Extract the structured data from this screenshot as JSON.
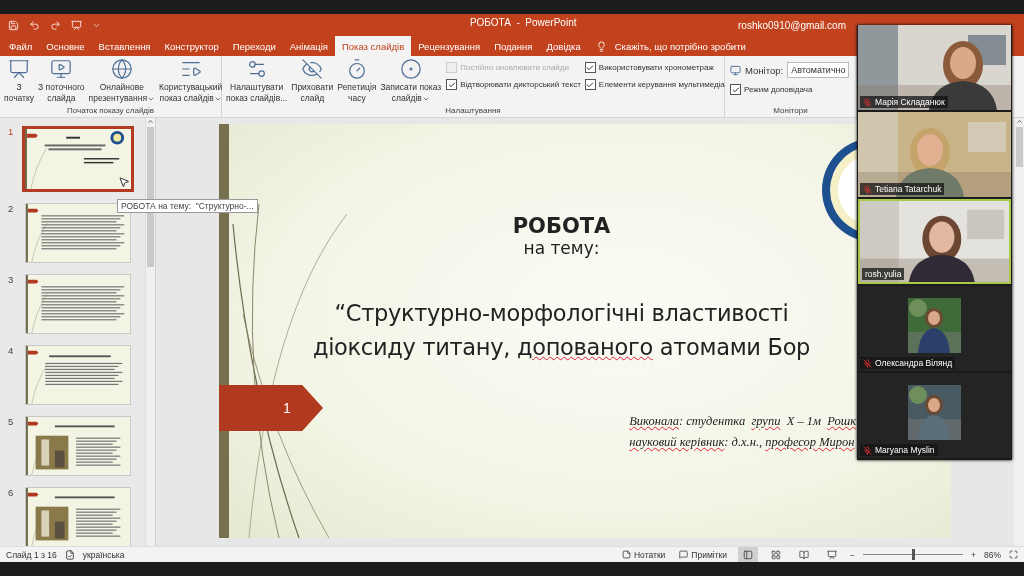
{
  "title_bar": {
    "title": "РОБОТА  -  PowerPoint",
    "account": "roshko0910@gmail.com"
  },
  "tabs": [
    {
      "label": "Файл",
      "selected": false
    },
    {
      "label": "Основне",
      "selected": false
    },
    {
      "label": "Вставлення",
      "selected": false
    },
    {
      "label": "Конструктор",
      "selected": false
    },
    {
      "label": "Переходи",
      "selected": false
    },
    {
      "label": "Анімація",
      "selected": false
    },
    {
      "label": "Показ слайдів",
      "selected": true
    },
    {
      "label": "Рецензування",
      "selected": false
    },
    {
      "label": "Подання",
      "selected": false
    },
    {
      "label": "Довідка",
      "selected": false
    }
  ],
  "tell_me": "Скажіть, що потрібно зробити",
  "ribbon_groups": [
    {
      "label": "Початок показу слайдів",
      "items": [
        {
          "kind": "button",
          "lines": [
            "З",
            "початку"
          ],
          "has_menu": false
        },
        {
          "kind": "button",
          "lines": [
            "З поточного",
            "слайда"
          ],
          "has_menu": false
        },
        {
          "kind": "button",
          "lines": [
            "Онлайнове",
            "презентування"
          ],
          "has_menu": true
        },
        {
          "kind": "button",
          "lines": [
            "Користувацький",
            "показ слайдів"
          ],
          "has_menu": true
        }
      ]
    },
    {
      "label": "Налаштування",
      "items": [
        {
          "kind": "button",
          "lines": [
            "Налаштувати",
            "показ слайдів..."
          ],
          "has_menu": false
        },
        {
          "kind": "button",
          "lines": [
            "Приховати",
            "слайд"
          ],
          "has_menu": false
        },
        {
          "kind": "button",
          "lines": [
            "Репетиція",
            "часу"
          ],
          "has_menu": false
        },
        {
          "kind": "button",
          "lines": [
            "Записати показ",
            "слайдів"
          ],
          "has_menu": true
        },
        {
          "kind": "checkboxes",
          "checkboxes": [
            {
              "label": "Постійно оновлювати слайди",
              "checked": false,
              "disabled": true
            },
            {
              "label": "Відтворювати дикторський текст",
              "checked": true,
              "disabled": false
            }
          ]
        },
        {
          "kind": "checkboxes",
          "checkboxes": [
            {
              "label": "Використовувати хронометраж",
              "checked": true,
              "disabled": false
            },
            {
              "label": "Елементи керування мультимедіа",
              "checked": true,
              "disabled": false
            }
          ]
        }
      ]
    },
    {
      "label": "Монітори",
      "items": [
        {
          "kind": "monitor",
          "label": "Монітор:",
          "value": "Автоматично",
          "checkboxes": [
            {
              "label": "Режим доповідача",
              "checked": true,
              "disabled": false
            }
          ]
        }
      ]
    }
  ],
  "thumbnails": [
    {
      "number": "1",
      "selected": true
    },
    {
      "number": "2",
      "selected": false
    },
    {
      "number": "3",
      "selected": false
    },
    {
      "number": "4",
      "selected": false
    },
    {
      "number": "5",
      "selected": false
    },
    {
      "number": "6",
      "selected": false
    }
  ],
  "tooltip": "РОБОТА на тему:  \"Структурно-...",
  "slide": {
    "number": "1",
    "heading": "РОБОТА",
    "subheading": "на тему:",
    "title_lines": [
      [
        {
          "text": "“Структурно-морфологічні властивості",
          "misspelled": false
        }
      ],
      [
        {
          "text": "діоксиду титану, ",
          "misspelled": false
        },
        {
          "text": "допованого",
          "misspelled": true
        },
        {
          "text": " атомами Бор",
          "misspelled": false
        }
      ]
    ],
    "credit_lines": [
      [
        {
          "text": "Виконала",
          "misspelled": true
        },
        {
          "text": ": студентка  ",
          "misspelled": false
        },
        {
          "text": "групи",
          "misspelled": true
        },
        {
          "text": "  Х – 1м  ",
          "misspelled": false
        },
        {
          "text": "Рошк",
          "misspelled": true
        }
      ],
      [
        {
          "text": "науковий керівник",
          "misspelled": true
        },
        {
          "text": ": д.х.н., ",
          "misspelled": false
        },
        {
          "text": "професор Мирон",
          "misspelled": true
        }
      ]
    ]
  },
  "video_call": {
    "participants": [
      {
        "name": "Марія Складанюк",
        "kind": "video",
        "muted": true,
        "speaking": false
      },
      {
        "name": "Tetiana Tatarchuk",
        "kind": "video",
        "muted": true,
        "speaking": false
      },
      {
        "name": "rosh.yulia",
        "kind": "video",
        "muted": false,
        "speaking": true
      },
      {
        "name": "Олександра Вілянд",
        "muted": true,
        "speaking": false
      },
      {
        "name": "Maryana Myslin",
        "muted": true,
        "speaking": false
      }
    ]
  },
  "status_bar": {
    "slide_position": "Слайд 1 з 16",
    "language": "українська",
    "notes": "Нотатки",
    "comments": "Примітки",
    "views": [
      {
        "kind": "normal",
        "selected": true
      },
      {
        "kind": "sorter",
        "selected": false
      },
      {
        "kind": "reading",
        "selected": false
      },
      {
        "kind": "slideshow",
        "selected": false
      }
    ],
    "zoom": {
      "minus": "−",
      "plus": "+",
      "level": 0.5,
      "reading": "86%"
    }
  }
}
